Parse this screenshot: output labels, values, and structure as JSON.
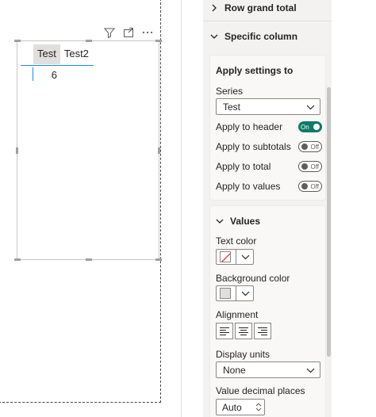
{
  "visual": {
    "columns": [
      "Test",
      "Test2"
    ],
    "rows": [
      [
        "6",
        ""
      ]
    ]
  },
  "pane": {
    "row_grand_total": "Row grand total",
    "specific_column": "Specific column",
    "apply_settings": {
      "title": "Apply settings to",
      "series_label": "Series",
      "series_value": "Test",
      "toggles": [
        {
          "label": "Apply to header",
          "state": "On"
        },
        {
          "label": "Apply to subtotals",
          "state": "Off"
        },
        {
          "label": "Apply to total",
          "state": "Off"
        },
        {
          "label": "Apply to values",
          "state": "Off"
        }
      ]
    },
    "values": {
      "title": "Values",
      "text_color_label": "Text color",
      "background_color_label": "Background color",
      "alignment_label": "Alignment",
      "display_units_label": "Display units",
      "display_units_value": "None",
      "decimal_places_label": "Value decimal places",
      "decimal_places_value": "Auto"
    }
  },
  "colors": {
    "accent": "#118dff",
    "toggle_on": "#0e7a67",
    "no_color_slash": "#d13438"
  }
}
